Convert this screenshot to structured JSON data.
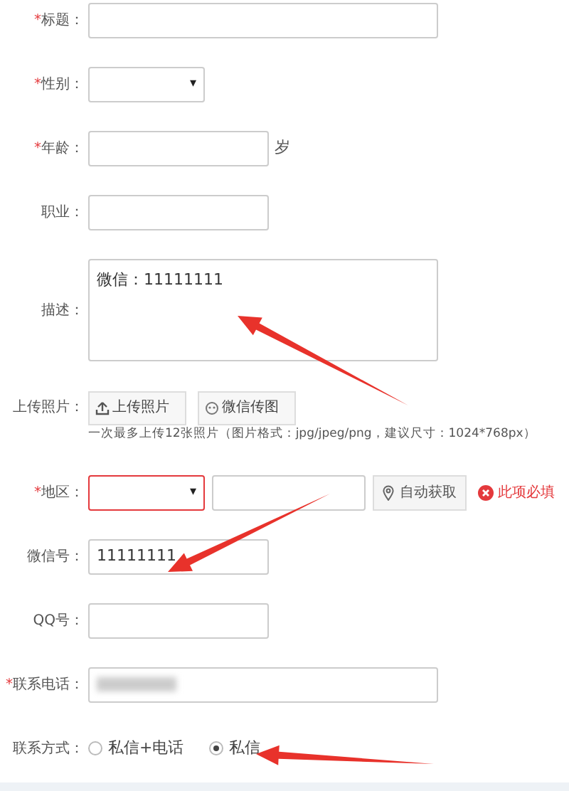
{
  "form": {
    "fields": [
      {
        "kind": "text_long",
        "label": "标题：",
        "required_mark": "*"
      },
      {
        "kind": "select",
        "label": "性别：",
        "required_mark": "*",
        "caret": "▾"
      },
      {
        "kind": "text",
        "label": "年龄：",
        "required_mark": "*",
        "suffix": "岁"
      },
      {
        "kind": "text",
        "label": "职业："
      },
      {
        "kind": "textarea",
        "label": "描述：",
        "value": "微信：11111111"
      },
      {
        "kind": "upload",
        "label": "上传照片：",
        "buttons": [
          "上传照片",
          "微信传图"
        ],
        "hint": "一次最多上传12张照片（图片格式：jpg/jpeg/png，建议尺寸：1024*768px）"
      },
      {
        "kind": "region",
        "label": "地区：",
        "required_mark": "*",
        "caret": "▾",
        "invalid": true,
        "button": "自动获取",
        "error": "此项必填"
      },
      {
        "kind": "text",
        "label": "微信号：",
        "value": "11111111"
      },
      {
        "kind": "text",
        "label": "QQ号："
      },
      {
        "kind": "text_long",
        "label": "联系电话：",
        "required_mark": "*",
        "redacted": true
      },
      {
        "kind": "radio",
        "label": "联系方式：",
        "options": [
          {
            "label": "私信+电话",
            "selected": false
          },
          {
            "label": "私信",
            "selected": true
          }
        ]
      }
    ]
  },
  "annotations": [
    {
      "kind": "arrow"
    },
    {
      "kind": "arrow"
    },
    {
      "kind": "arrow"
    }
  ]
}
